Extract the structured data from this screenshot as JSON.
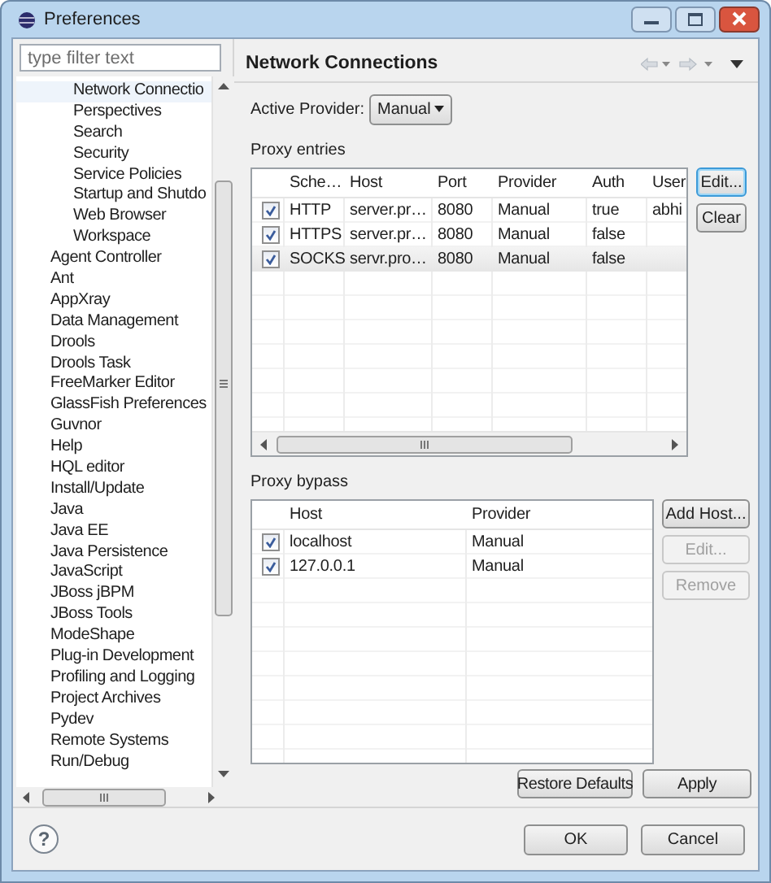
{
  "window": {
    "title": "Preferences"
  },
  "filter": {
    "placeholder": "type filter text"
  },
  "tree": {
    "items": [
      {
        "children": [
          {
            "label": "Network Connectio",
            "selected": true
          },
          {
            "label": "Perspectives",
            "selected": false
          },
          {
            "label": "Search",
            "selected": false
          },
          {
            "label": "Security",
            "selected": false
          },
          {
            "label": "Service Policies",
            "selected": false
          },
          {
            "label": "Startup and Shutdo",
            "selected": false
          },
          {
            "label": "Web Browser",
            "selected": false
          },
          {
            "label": "Workspace",
            "selected": false
          }
        ]
      },
      {
        "label": "Agent Controller",
        "selected": false
      },
      {
        "label": "Ant",
        "selected": false
      },
      {
        "label": "AppXray",
        "selected": false
      },
      {
        "label": "Data Management",
        "selected": false
      },
      {
        "label": "Drools",
        "selected": false
      },
      {
        "label": "Drools Task",
        "selected": false
      },
      {
        "label": "FreeMarker Editor",
        "selected": false
      },
      {
        "label": "GlassFish Preferences",
        "selected": false
      },
      {
        "label": "Guvnor",
        "selected": false
      },
      {
        "label": "Help",
        "selected": false
      },
      {
        "label": "HQL editor",
        "selected": false
      },
      {
        "label": "Install/Update",
        "selected": false
      },
      {
        "label": "Java",
        "selected": false
      },
      {
        "label": "Java EE",
        "selected": false
      },
      {
        "label": "Java Persistence",
        "selected": false
      },
      {
        "label": "JavaScript",
        "selected": false
      },
      {
        "label": "JBoss jBPM",
        "selected": false
      },
      {
        "label": "JBoss Tools",
        "selected": false
      },
      {
        "label": "ModeShape",
        "selected": false
      },
      {
        "label": "Plug-in Development",
        "selected": false
      },
      {
        "label": "Profiling and Logging",
        "selected": false
      },
      {
        "label": "Project Archives",
        "selected": false
      },
      {
        "label": "Pydev",
        "selected": false
      },
      {
        "label": "Remote Systems",
        "selected": false
      },
      {
        "label": "Run/Debug",
        "selected": false
      }
    ]
  },
  "page": {
    "title": "Network Connections"
  },
  "active_provider": {
    "label": "Active Provider:",
    "value": "Manual"
  },
  "proxy_entries": {
    "label": "Proxy entries",
    "columns": [
      "Sche…",
      "Host",
      "Port",
      "Provider",
      "Auth",
      "User"
    ],
    "rows": [
      {
        "checked": true,
        "selected": false,
        "cells": [
          "HTTP",
          "server.pr…",
          "8080",
          "Manual",
          "true",
          "abhi"
        ]
      },
      {
        "checked": true,
        "selected": false,
        "cells": [
          "HTTPS",
          "server.pr…",
          "8080",
          "Manual",
          "false",
          ""
        ]
      },
      {
        "checked": true,
        "selected": true,
        "cells": [
          "SOCKS",
          "servr.pro…",
          "8080",
          "Manual",
          "false",
          ""
        ]
      }
    ],
    "buttons": [
      {
        "label": "Edit...",
        "disabled": false,
        "focused": true
      },
      {
        "label": "Clear",
        "disabled": false,
        "focused": false
      }
    ]
  },
  "proxy_bypass": {
    "label": "Proxy bypass",
    "columns": [
      "Host",
      "Provider"
    ],
    "rows": [
      {
        "checked": true,
        "selected": false,
        "cells": [
          "localhost",
          "Manual"
        ]
      },
      {
        "checked": true,
        "selected": false,
        "cells": [
          "127.0.0.1",
          "Manual"
        ]
      }
    ],
    "buttons": [
      {
        "label": "Add Host...",
        "disabled": false,
        "focused": false
      },
      {
        "label": "Edit...",
        "disabled": true,
        "focused": false
      },
      {
        "label": "Remove",
        "disabled": true,
        "focused": false
      }
    ]
  },
  "page_buttons": [
    "Restore Defaults",
    "Apply"
  ],
  "help_button": "?",
  "dialog_buttons": [
    "OK",
    "Cancel"
  ]
}
